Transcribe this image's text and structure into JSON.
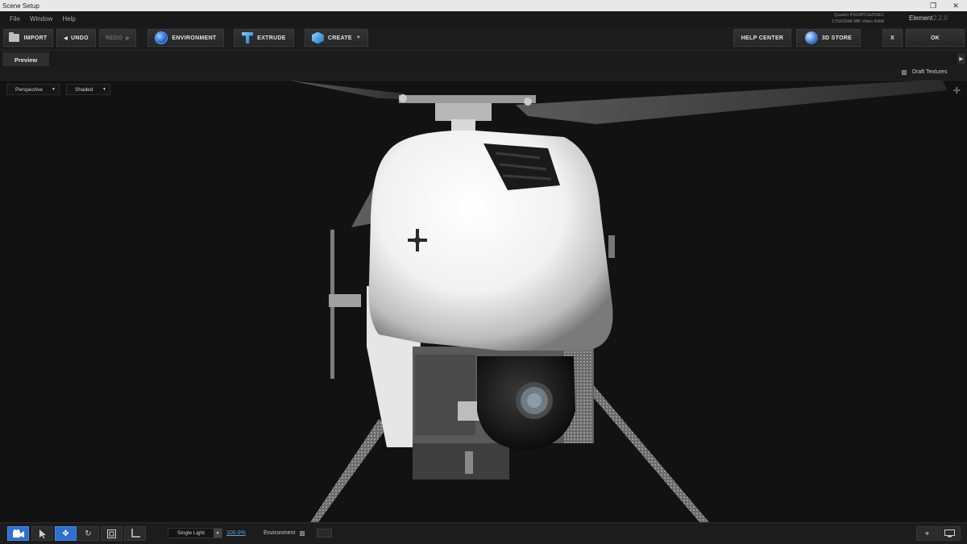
{
  "window": {
    "title": "Scene Setup",
    "controls": {
      "restore": "❐",
      "close": "✕"
    }
  },
  "menu": {
    "items": [
      "File",
      "Window",
      "Help"
    ]
  },
  "sysinfo": {
    "gpu": "Quadro P600/PCIe/SSE2",
    "vram": "1759/2048 MB Video RAM"
  },
  "plugin": {
    "name": "Element",
    "version": "2.2.0"
  },
  "toolbar": {
    "import": "IMPORT",
    "undo": "UNDO",
    "redo": "REDO",
    "environment": "ENVIRONMENT",
    "extrude": "EXTRUDE",
    "create": "CREATE",
    "help_center": "HELP CENTER",
    "store": "3D STORE",
    "cancel": "X",
    "ok": "OK"
  },
  "tabs": {
    "preview": "Preview"
  },
  "options": {
    "draft_textures": "Draft Textures"
  },
  "viewport": {
    "camera": "Perspective",
    "shading": "Shaded"
  },
  "bottom": {
    "light": "Single Light",
    "light_pct": "100.0%",
    "environment": "Environment"
  },
  "colors": {
    "accent": "#2f6fd0",
    "link": "#5aa8e6",
    "background": "#121212"
  },
  "icons": {
    "import": "folder-icon",
    "environment": "globe-icon",
    "extrude": "extrude-icon",
    "create": "cube-icon",
    "store": "store-icon",
    "bottom_tools": [
      "camera-icon",
      "select-arrow-icon",
      "move-icon",
      "rotate-icon",
      "scale-icon",
      "axis-icon"
    ],
    "bottom_right": [
      "target-icon",
      "screen-icon"
    ]
  }
}
